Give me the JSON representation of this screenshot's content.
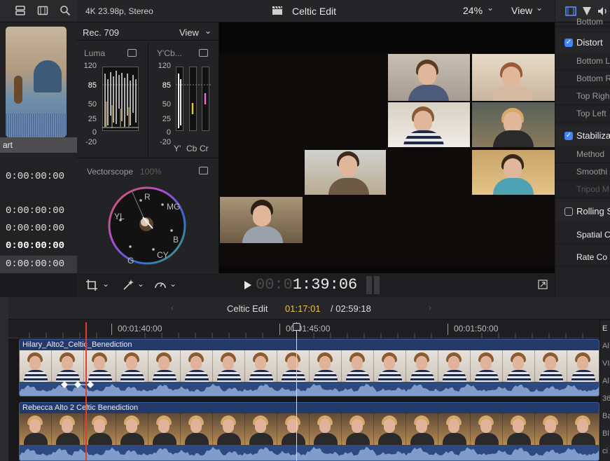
{
  "toolbar": {
    "format": "4K 23.98p, Stereo",
    "project": "Celtic Edit",
    "zoom": "24%",
    "zoom_chevron": "⌄",
    "view": "View",
    "view_chevron": "⌄"
  },
  "browser": {
    "column_header": "art",
    "timecodes": [
      "0:00:00:00",
      "0:00:00:00",
      "0:00:00:00",
      "0:00:00:00",
      "0:00:00:00",
      "0:00:00:00"
    ]
  },
  "scopes": {
    "colorspace": "Rec. 709",
    "view": "View",
    "luma": {
      "label": "Luma",
      "ticks": [
        "120",
        "85",
        "50",
        "25",
        "0",
        "-20"
      ]
    },
    "ycbcr": {
      "label": "Y'Cb...",
      "ticks": [
        "120",
        "85",
        "50",
        "25",
        "0",
        "-20"
      ],
      "channels": [
        "Y'",
        "Cb",
        "Cr"
      ]
    },
    "vectorscope": {
      "label": "Vectorscope",
      "percent": "100%",
      "targets": [
        "R",
        "MG",
        "B",
        "CY",
        "G",
        "YL"
      ]
    }
  },
  "viewer": {
    "timecode_dim": "00:0",
    "timecode": "1:39:06"
  },
  "timeline": {
    "title": "Celtic Edit",
    "position": "01:17:01",
    "duration": "/ 02:59:18",
    "ruler": [
      "00:01:40:00",
      "00:01:45:00",
      "00:01:50:00"
    ],
    "clips": [
      {
        "name": "Hilary_Alto2_Celtic_Benediction"
      },
      {
        "name": "Rebecca Alto 2 Celtic Benediction"
      }
    ]
  },
  "inspector": {
    "cut_label": "Bottom",
    "sections": [
      {
        "label": "Distort",
        "checked": true
      },
      {
        "label": "Stabiliza",
        "checked": true
      },
      {
        "label": "Rolling S",
        "checked": false
      }
    ],
    "distort_rows": [
      "Bottom L",
      "Bottom R",
      "Top Righ",
      "Top Left"
    ],
    "stabilize_rows": [
      "Method",
      "Smoothi",
      "Tripod M"
    ],
    "spatial": "Spatial C",
    "rate": "Rate Co"
  },
  "index_panel": [
    "E",
    "Al",
    "VI",
    "Al",
    "36",
    "Ba",
    "Bl",
    "ci"
  ],
  "colors": {
    "accent_blue": "#3f86ff",
    "clip_blue": "#22396a",
    "playhead_red": "#e0402a",
    "position_yellow": "#e9c44a"
  }
}
